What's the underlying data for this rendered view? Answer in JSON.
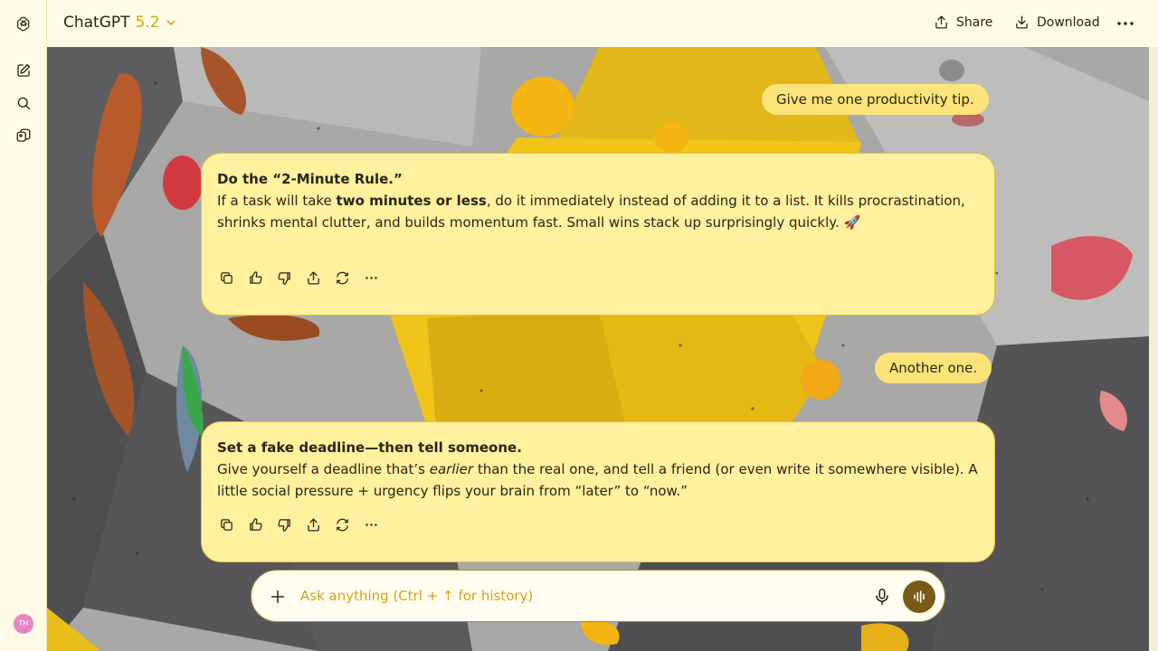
{
  "header": {
    "app_name": "ChatGPT",
    "model_version": "5.2",
    "share_label": "Share",
    "download_label": "Download"
  },
  "sidebar": {
    "user_initials": "TH"
  },
  "conversation": [
    {
      "role": "user",
      "text": "Give me one productivity tip."
    },
    {
      "role": "assistant",
      "title": "Do the “2-Minute Rule.”",
      "segments": [
        "If a task will take ",
        "two minutes or less",
        ", do it immediately instead of adding it to a list. It kills procrastination, shrinks mental clutter, and builds momentum fast. Small wins stack up surprisingly quickly. 🚀"
      ]
    },
    {
      "role": "user",
      "text": "Another one."
    },
    {
      "role": "assistant",
      "title": "Set a fake deadline—then tell someone.",
      "segments": [
        "Give yourself a deadline that’s ",
        "earlier",
        " than the real one, and tell a friend (or even write it somewhere visible). A little social pressure + urgency flips your brain from “later” to “now.”"
      ]
    }
  ],
  "composer": {
    "placeholder": "Ask anything (Ctrl + ↑ for history)"
  },
  "theme": {
    "background": "#fffbe6",
    "accent": "#d3a415",
    "assistant_card": "#fff19e",
    "user_bubble": "#fde47a",
    "voice_button": "#7b5a17"
  },
  "icons": [
    "openai-logo-icon",
    "new-chat-icon",
    "search-icon",
    "library-icon",
    "chevron-down-icon",
    "share-icon",
    "download-icon",
    "more-icon",
    "copy-icon",
    "thumbs-up-icon",
    "thumbs-down-icon",
    "upload-icon",
    "regenerate-icon",
    "plus-icon",
    "mic-icon",
    "voice-mode-icon"
  ]
}
